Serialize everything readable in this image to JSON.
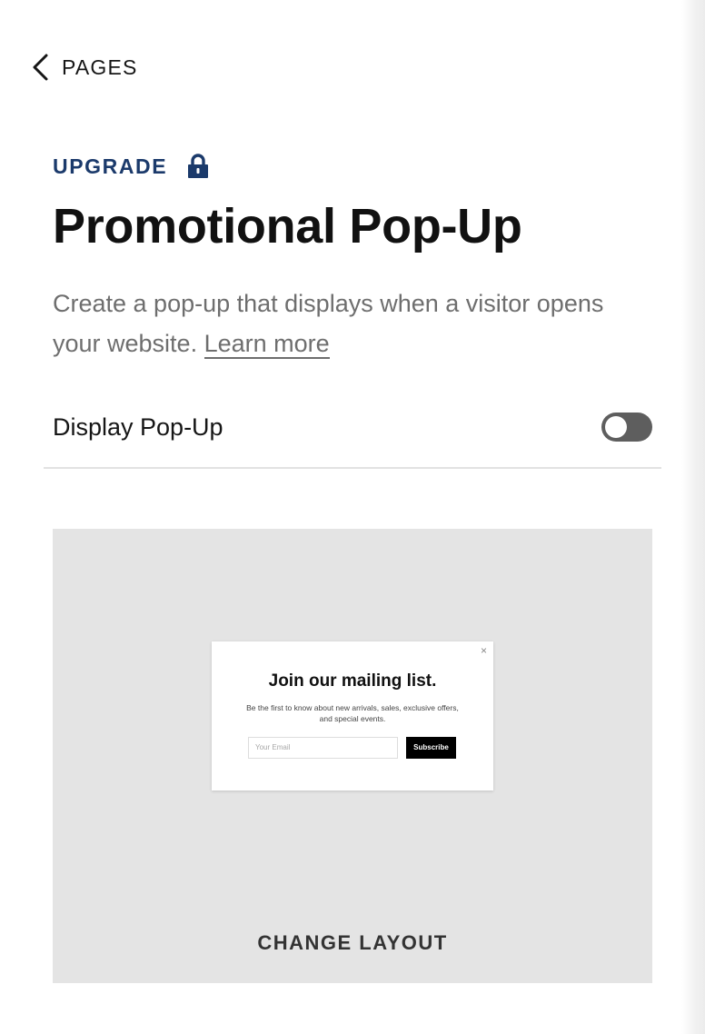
{
  "nav": {
    "back_label": "PAGES",
    "back_icon": "chevron-left-icon"
  },
  "badge": {
    "upgrade_label": "UPGRADE",
    "icon": "lock-icon",
    "color": "#1b3a6b"
  },
  "header": {
    "title": "Promotional Pop-Up",
    "description": "Create a pop-up that displays when a visitor opens your website.",
    "learn_more": "Learn more"
  },
  "setting": {
    "label": "Display Pop-Up",
    "enabled": false
  },
  "preview": {
    "popup": {
      "close_symbol": "×",
      "title": "Join our mailing list.",
      "text": "Be the first to know about new arrivals, sales, exclusive offers, and special events.",
      "email_placeholder": "Your Email",
      "button_label": "Subscribe"
    },
    "change_layout_label": "CHANGE LAYOUT"
  }
}
